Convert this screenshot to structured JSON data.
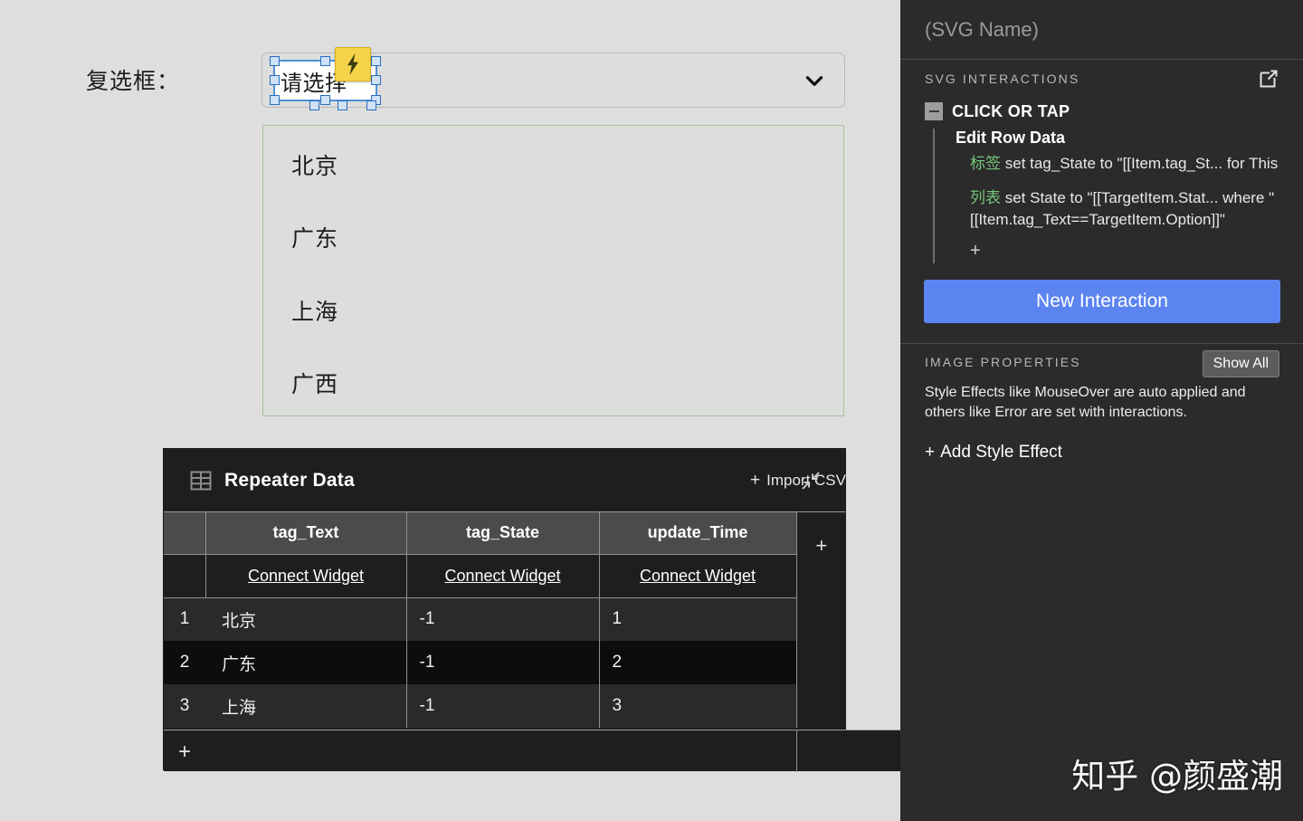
{
  "canvas": {
    "background_color": "#dedede",
    "field": {
      "label": "复选框：",
      "dropdown": {
        "selected_text": "请选择",
        "chevron_icon": "chevron-down-icon",
        "interaction_badge_icon": "lightning-bolt-icon"
      }
    },
    "listbox": {
      "border_color": "#a8bf9d",
      "options": [
        "北京",
        "广东",
        "上海",
        "广西"
      ]
    }
  },
  "repeater": {
    "title": "Repeater Data",
    "grid_icon": "table-grid-icon",
    "import_label": "Import CSV",
    "import_plus": "+",
    "collapse_icon": "collapse-arrows-icon",
    "columns": [
      "tag_Text",
      "tag_State",
      "update_Time"
    ],
    "connect_widget_label": "Connect Widget",
    "add_column_plus": "+",
    "add_row_plus": "+",
    "rows": [
      {
        "num": "1",
        "tag_Text": "北京",
        "tag_State": "-1",
        "update_Time": "1"
      },
      {
        "num": "2",
        "tag_Text": "广东",
        "tag_State": "-1",
        "update_Time": "2"
      },
      {
        "num": "3",
        "tag_Text": "上海",
        "tag_State": "-1",
        "update_Time": "3"
      }
    ]
  },
  "inspector": {
    "widget_name_placeholder": "(SVG Name)",
    "interactions": {
      "section_title": "SVG INTERACTIONS",
      "popout_icon": "external-link-icon",
      "event_name": "CLICK OR TAP",
      "collapse_icon": "minus-square-icon",
      "case_name": "Edit Row Data",
      "actions": [
        {
          "target": "标签",
          "text": " set tag_State to \"[[Item.tag_St... for This"
        },
        {
          "target": "列表",
          "text": " set State to \"[[TargetItem.Stat... where \"[[Item.tag_Text==TargetItem.Option]]\""
        }
      ],
      "add_action_plus": "+",
      "new_interaction_label": "New Interaction",
      "new_interaction_color": "#5b84f0"
    },
    "image_properties": {
      "section_title": "IMAGE PROPERTIES",
      "show_all_label": "Show All",
      "description": "Style Effects like MouseOver are auto applied and others like Error are set with interactions.",
      "add_style_plus": "+",
      "add_style_label": "Add Style Effect"
    }
  },
  "watermark": {
    "text": "知乎 @颜盛潮"
  }
}
